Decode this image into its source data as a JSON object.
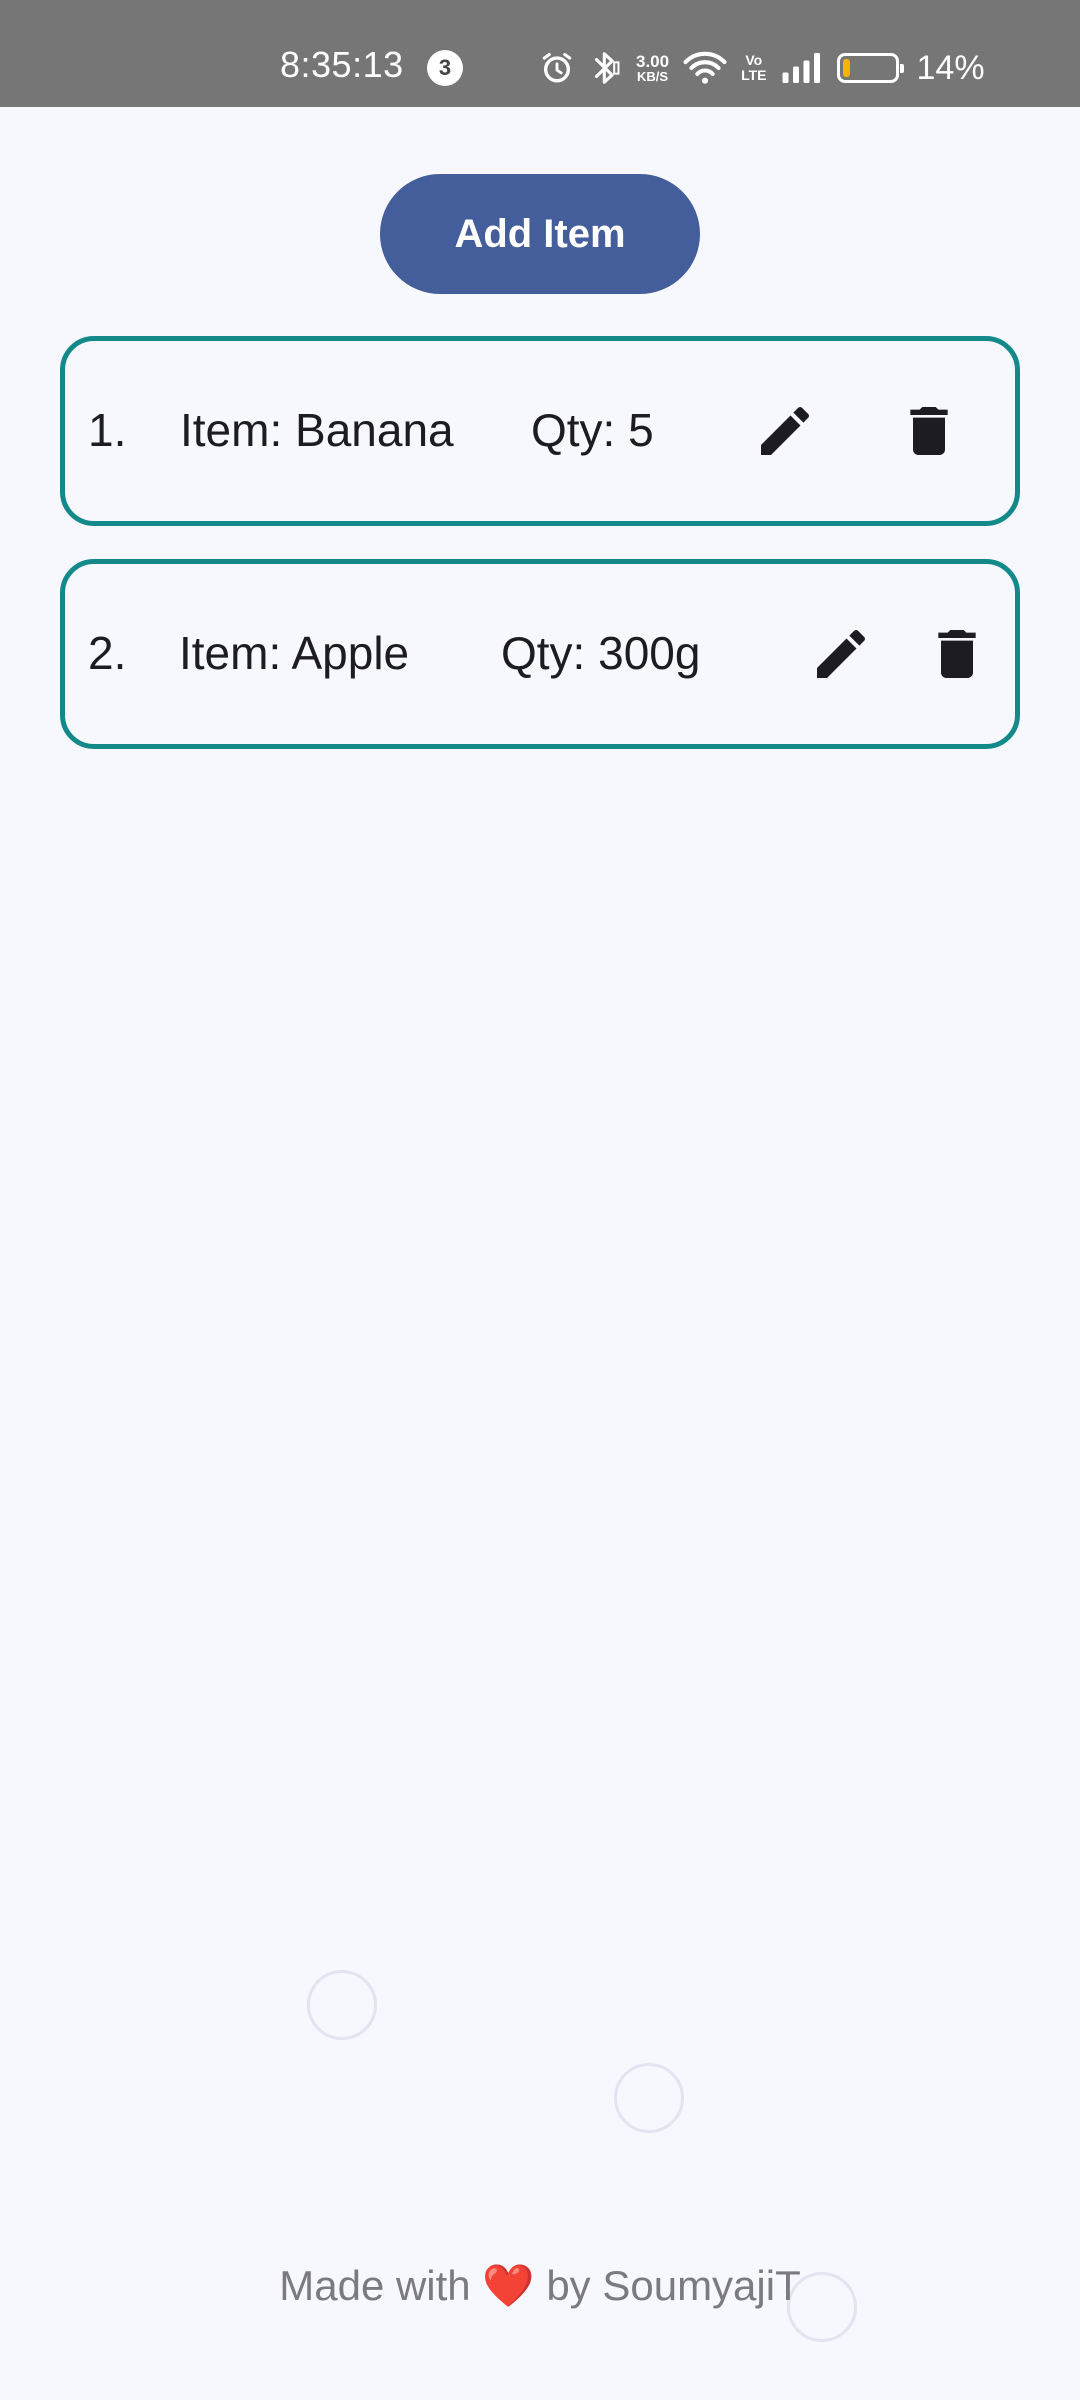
{
  "status_bar": {
    "time": "8:35:13",
    "notification_count": "3",
    "net_speed": "3.00",
    "net_speed_unit": "KB/S",
    "volte_top": "Vo",
    "volte_bottom": "LTE",
    "battery_percent": "14%",
    "battery_level": 0.14,
    "icons": [
      "alarm-icon",
      "bluetooth-icon",
      "wifi-icon",
      "signal-icon",
      "battery-icon"
    ]
  },
  "add_button": {
    "label": "Add Item"
  },
  "items": [
    {
      "index": "1.",
      "name": "Item: Banana",
      "qty": "Qty: 5"
    },
    {
      "index": "2.",
      "name": "Item: Apple",
      "qty": "Qty: 300g"
    }
  ],
  "footer": {
    "prefix": "Made with",
    "heart": "❤️",
    "suffix": "by SoumyajiT"
  },
  "colors": {
    "background": "#f7f8fd",
    "status_bar": "#767676",
    "button": "#445e9b",
    "card_border": "#13898a",
    "battery_fill": "#f4b400",
    "heart": "#e0323d"
  }
}
